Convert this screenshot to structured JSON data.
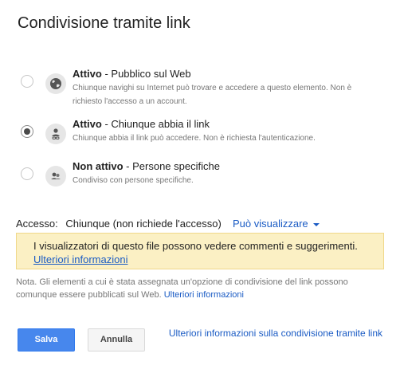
{
  "dialog": {
    "title": "Condivisione tramite link"
  },
  "options": [
    {
      "name_bold": "Attivo",
      "name_rest": " - Pubblico sul Web",
      "desc": "Chiunque navighi su Internet può trovare e accedere a questo elemento. Non è richiesto l'accesso a un account.",
      "icon": "globe-icon",
      "checked": false
    },
    {
      "name_bold": "Attivo",
      "name_rest": " - Chiunque abbia il link",
      "desc": "Chiunque abbia il link può accedere. Non è richiesta l'autenticazione.",
      "icon": "link-user-icon",
      "checked": true
    },
    {
      "name_bold": "Non attivo",
      "name_rest": " - Persone specifiche",
      "desc": "Condiviso con persone specifiche.",
      "icon": "people-icon",
      "checked": false
    }
  ],
  "access": {
    "label": "Accesso:",
    "value": "Chiunque (non richiede l'accesso)",
    "select": "Può visualizzare"
  },
  "notice": {
    "text": "I visualizzatori di questo file possono vedere commenti e suggerimenti.",
    "link": "Ulteriori informazioni"
  },
  "note": {
    "text": "Nota. Gli elementi a cui è stata assegnata un'opzione di condivisione del link possono comunque essere pubblicati sul Web.",
    "link": "Ulteriori informazioni"
  },
  "buttons": {
    "save": "Salva",
    "cancel": "Annulla"
  },
  "footer": {
    "more_link": "Ulteriori informazioni sulla condivisione tramite link"
  },
  "colors": {
    "accent": "#4787ed",
    "link": "#1a5bc4",
    "notice_bg": "#fbf0c4"
  }
}
